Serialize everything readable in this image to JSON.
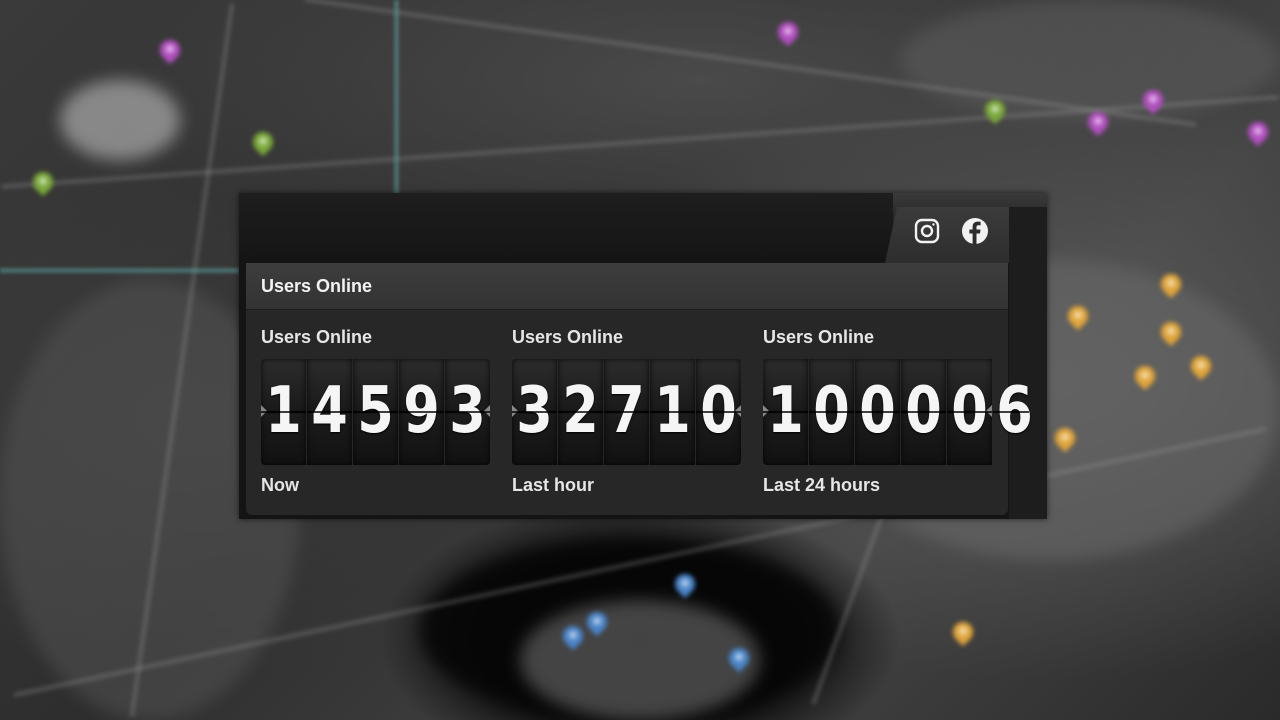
{
  "widget": {
    "header_title": "Users Online",
    "social": {
      "instagram": "instagram-icon",
      "facebook": "facebook-icon"
    },
    "counters": [
      {
        "label": "Users Online",
        "digits": [
          "1",
          "4",
          "5",
          "9",
          "3"
        ],
        "sublabel": "Now"
      },
      {
        "label": "Users Online",
        "digits": [
          "3",
          "2",
          "7",
          "1",
          "0"
        ],
        "sublabel": "Last hour"
      },
      {
        "label": "Users Online",
        "digits": [
          "1",
          "0",
          "0",
          "0",
          "0",
          "6"
        ],
        "sublabel": "Last 24 hours"
      }
    ]
  },
  "colors": {
    "panel": "#272727",
    "header": "#3a3a3a",
    "text": "#f3f3f3",
    "pin_purple": "#b24fc0",
    "pin_green": "#7aa83a",
    "pin_orange": "#e0a53a",
    "pin_blue": "#4a84c8"
  }
}
